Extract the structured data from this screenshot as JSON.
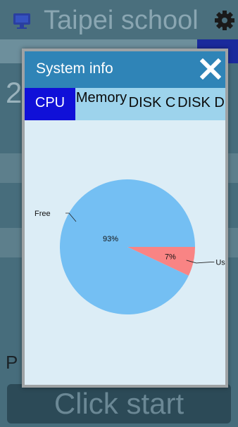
{
  "app": {
    "title": "Taipei school",
    "background_number": "2",
    "background_letter": "P",
    "start_button": "Click start"
  },
  "modal": {
    "title": "System info",
    "tabs": [
      {
        "label": "CPU",
        "active": true
      },
      {
        "label": "Memory",
        "active": false
      },
      {
        "label": "DISK C",
        "active": false
      },
      {
        "label": "DISK D",
        "active": false
      }
    ]
  },
  "chart_data": {
    "type": "pie",
    "slices": [
      {
        "label": "Used",
        "value": 7,
        "display": "7%",
        "color": "#f98484"
      },
      {
        "label": "Free",
        "value": 93,
        "display": "93%",
        "color": "#74bff3"
      }
    ]
  },
  "colors": {
    "modal_header": "#2f84b7",
    "active_tab": "#1010d8",
    "tab_bar": "#9dd3ec"
  }
}
